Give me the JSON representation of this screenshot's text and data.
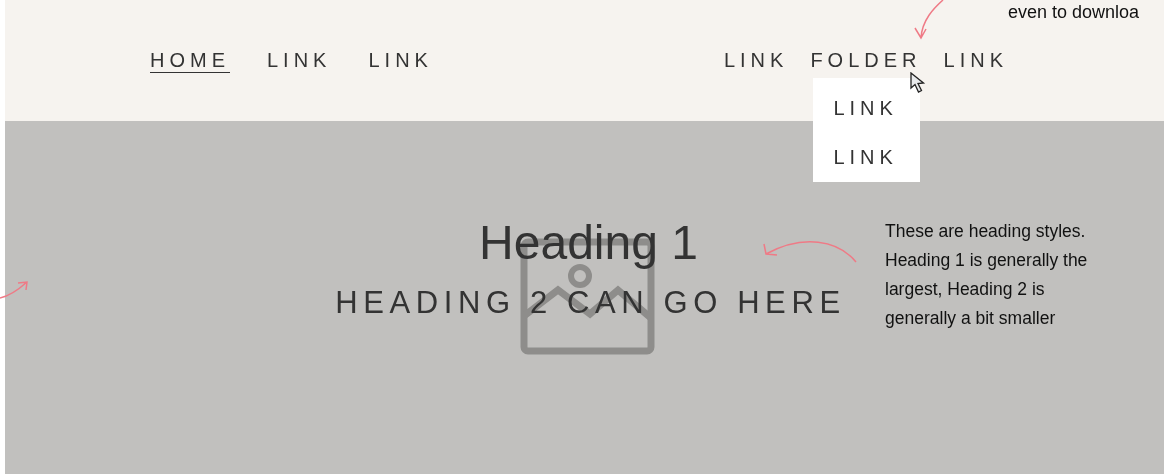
{
  "nav": {
    "left": [
      {
        "label": "HOME",
        "selected": true
      },
      {
        "label": "LINK",
        "selected": false
      },
      {
        "label": "LINK",
        "selected": false
      }
    ],
    "right": [
      {
        "kind": "link",
        "label": "LINK"
      },
      {
        "kind": "folder",
        "label": "FOLDER",
        "expanded": true,
        "children": [
          {
            "label": "LINK"
          },
          {
            "label": "LINK"
          }
        ]
      },
      {
        "kind": "link",
        "label": "LINK"
      }
    ]
  },
  "top_note": "even to downloa",
  "hero": {
    "heading_1": "Heading 1",
    "heading_2": "HEADING 2 CAN GO HERE",
    "note": "These are heading styles. Heading 1 is generally the largest, Heading 2 is generally a bit smaller"
  }
}
